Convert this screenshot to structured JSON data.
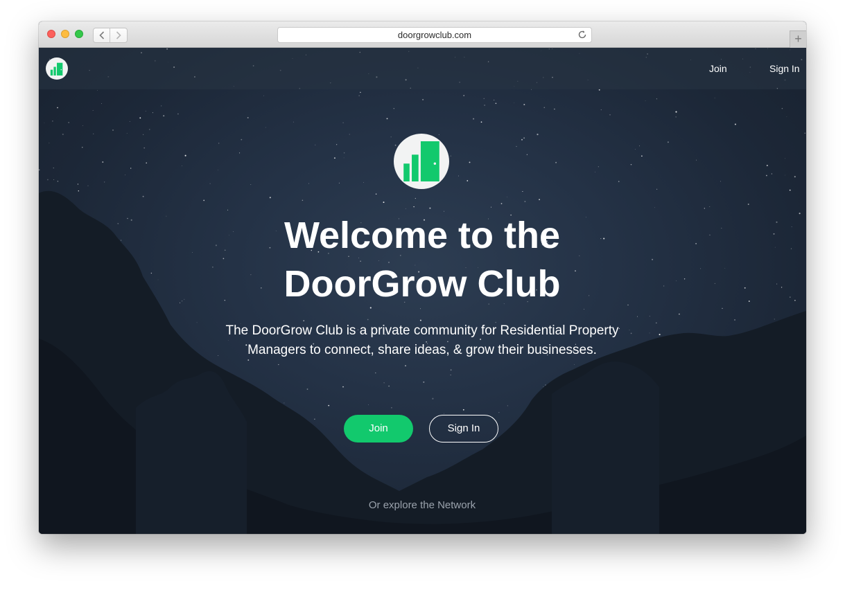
{
  "browser": {
    "url": "doorgrowclub.com",
    "new_tab_label": "+"
  },
  "nav": {
    "join_label": "Join",
    "signin_label": "Sign In"
  },
  "hero": {
    "title": "Welcome to the DoorGrow Club",
    "subtitle": "The DoorGrow Club is a private community for Residential Property Managers to connect, share ideas, & grow their businesses.",
    "join_label": "Join",
    "signin_label": "Sign In",
    "explore_label": "Or explore the Network"
  },
  "colors": {
    "brand_green": "#12c96d",
    "logo_bg": "#f2f3f3"
  },
  "icons": {
    "logo": "doorgrow-logo-icon",
    "back": "chevron-left-icon",
    "forward": "chevron-right-icon",
    "reload": "reload-icon"
  }
}
